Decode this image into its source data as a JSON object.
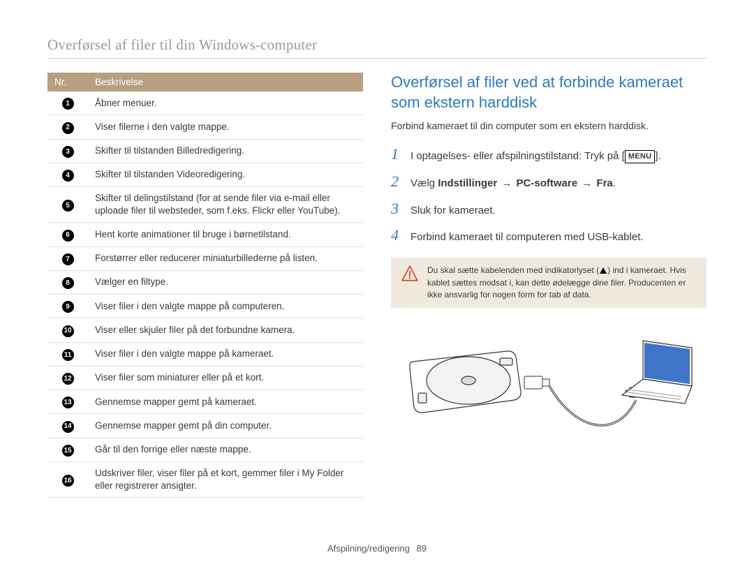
{
  "page_title": "Overførsel af filer til din Windows-computer",
  "table": {
    "head_nr": "Nr.",
    "head_desc": "Beskrivelse",
    "rows": [
      {
        "n": "1",
        "txt": "Åbner menuer."
      },
      {
        "n": "2",
        "txt": "Viser filerne i den valgte mappe."
      },
      {
        "n": "3",
        "txt": "Skifter til tilstanden Billedredigering."
      },
      {
        "n": "4",
        "txt": "Skifter til tilstanden Videoredigering."
      },
      {
        "n": "5",
        "txt": "Skifter til delingstilstand (for at sende filer via e-mail eller uploade filer til websteder, som f.eks. Flickr eller YouTube)."
      },
      {
        "n": "6",
        "txt": "Hent korte animationer til bruge i børnetilstand."
      },
      {
        "n": "7",
        "txt": "Forstørrer eller reducerer miniaturbillederne på listen."
      },
      {
        "n": "8",
        "txt": "Vælger en filtype."
      },
      {
        "n": "9",
        "txt": "Viser filer i den valgte mappe på computeren."
      },
      {
        "n": "10",
        "txt": "Viser eller skjuler filer på det forbundne kamera."
      },
      {
        "n": "11",
        "txt": "Viser filer i den valgte mappe på kameraet."
      },
      {
        "n": "12",
        "txt": "Viser filer som miniaturer eller på et kort."
      },
      {
        "n": "13",
        "txt": "Gennemse mapper gemt på kameraet."
      },
      {
        "n": "14",
        "txt": "Gennemse mapper gemt på din computer."
      },
      {
        "n": "15",
        "txt": "Går til den forrige eller næste mappe."
      },
      {
        "n": "16",
        "txt": "Udskriver filer, viser filer på et kort, gemmer filer i My Folder eller registrerer ansigter."
      }
    ]
  },
  "section": {
    "heading": "Overførsel af filer ved at forbinde kameraet som ekstern harddisk",
    "intro": "Forbind kameraet til din computer som en ekstern harddisk.",
    "steps": {
      "s1_pre": "I optagelses- eller afspilningstilstand: Tryk på [",
      "s1_menu": "MENU",
      "s1_post": "].",
      "s2_pre": "Vælg ",
      "s2_b1": "Indstillinger",
      "s2_b2": "PC-software",
      "s2_b3": "Fra",
      "s2_post": ".",
      "s3": "Sluk for kameraet.",
      "s4": "Forbind kameraet til computeren med USB-kablet."
    },
    "warning": {
      "pre": "Du skal sætte kabelenden med indikatorlyset (",
      "post": ") ind i kameraet. Hvis kablet sættes modsat i, kan dette ødelægge dine filer. Producenten er ikke ansvarlig for nogen form for tab af data."
    }
  },
  "footer": {
    "section": "Afspilning/redigering",
    "page": "89"
  }
}
